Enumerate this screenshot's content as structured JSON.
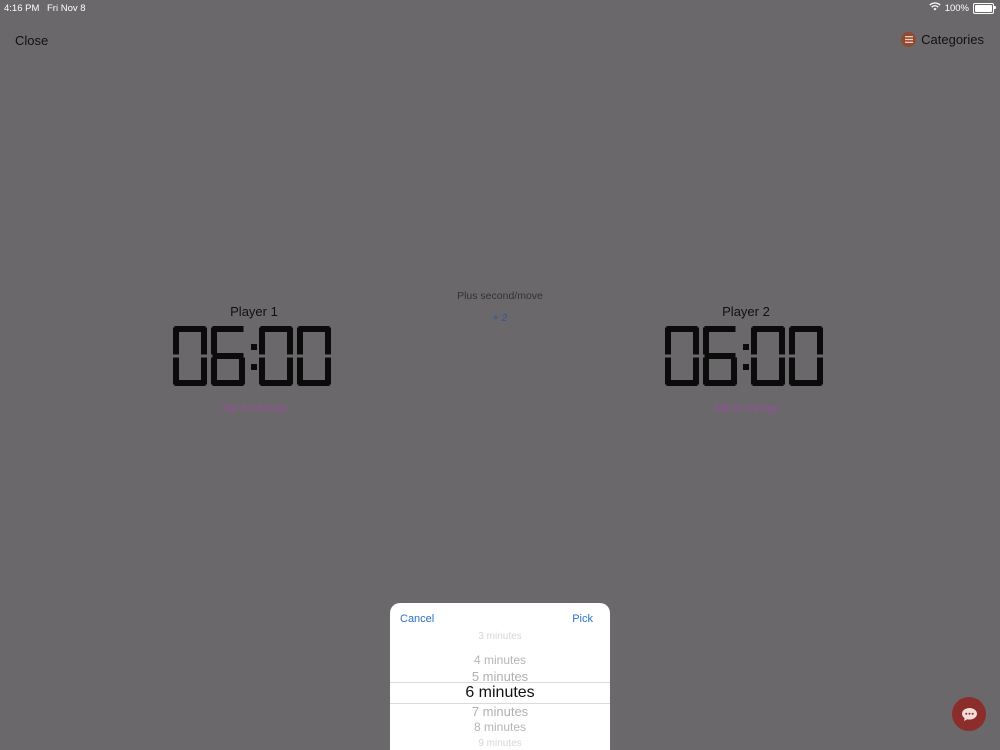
{
  "status_bar": {
    "time": "4:16 PM",
    "date": "Fri Nov 8",
    "battery": "100%"
  },
  "nav": {
    "close_label": "Close",
    "categories_label": "Categories"
  },
  "player1": {
    "label": "Player 1",
    "time": "06:00",
    "hint": "Tap to change"
  },
  "player2": {
    "label": "Player 2",
    "time": "06:00",
    "hint": "Tap to change"
  },
  "increment": {
    "label": "Plus second/move",
    "value": "+ 2"
  },
  "picker": {
    "cancel_label": "Cancel",
    "pick_label": "Pick",
    "options": [
      "3 minutes",
      "4 minutes",
      "5 minutes",
      "6 minutes",
      "7 minutes",
      "8 minutes",
      "9 minutes"
    ],
    "selected": "6 minutes"
  },
  "colors": {
    "backdrop": "#6a686b",
    "accent_blue": "#2a73c8",
    "hint_purple": "#9a4d9e",
    "chat_button": "#8a2d2b"
  },
  "icons": {
    "wifi": "wifi-icon",
    "battery": "battery-icon",
    "categories": "list-icon",
    "chat": "chat-bubble-icon"
  }
}
